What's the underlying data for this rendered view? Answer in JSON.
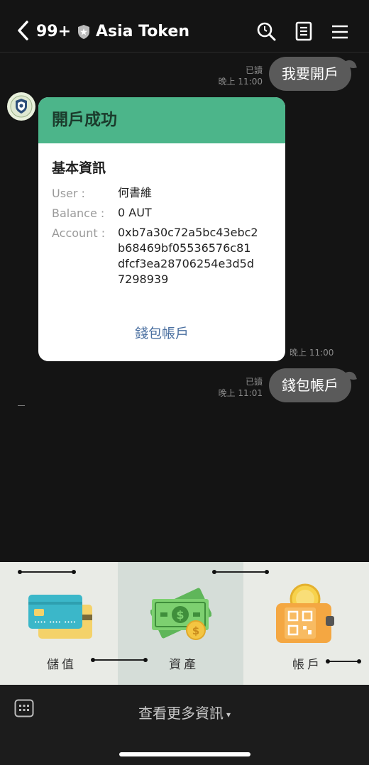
{
  "header": {
    "unread_count": "99+",
    "title": "Asia Token",
    "icons": [
      "chevron-left-icon",
      "shield-icon",
      "search-icon",
      "notes-icon",
      "menu-icon"
    ]
  },
  "messages": {
    "out1": {
      "read": "已讀",
      "time": "晚上 11:00",
      "text": "我要開戶"
    },
    "card": {
      "title": "開戶成功",
      "section": "基本資訊",
      "user_label": "User :",
      "user_value": "何書維",
      "balance_label": "Balance :",
      "balance_value": "0 AUT",
      "account_label": "Account :",
      "account_line1": "0xb7a30c72a5bc43ebc2",
      "account_line2": "b68469bf05536576c81",
      "account_line3": "dfcf3ea28706254e3d5d",
      "account_line4": "7298939",
      "link": "錢包帳戶",
      "time": "晚上 11:00"
    },
    "out2": {
      "read": "已讀",
      "time": "晚上 11:01",
      "text": "錢包帳戶"
    }
  },
  "richmenu": {
    "items": [
      {
        "label": "儲值",
        "icon": "credit-card-icon"
      },
      {
        "label": "資產",
        "icon": "money-icon"
      },
      {
        "label": "帳戶",
        "icon": "wallet-qr-icon"
      }
    ]
  },
  "bottombar": {
    "more_info": "查看更多資訊",
    "caret": "▾"
  },
  "colors": {
    "card_header": "#4cb58a",
    "bubble": "#5a5a5a",
    "link": "#4a6fa0"
  }
}
